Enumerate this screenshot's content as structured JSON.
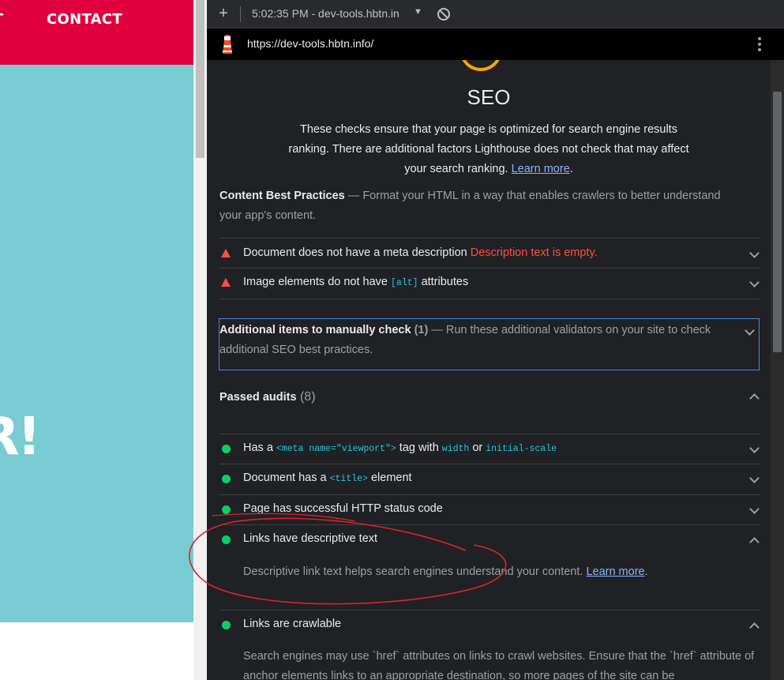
{
  "site": {
    "nav": [
      "UT",
      "CONTACT"
    ],
    "hero_text": "R!",
    "colors": {
      "header": "#e1003e",
      "hero": "#78ccd2"
    }
  },
  "devtools": {
    "report_select": "5:02:35 PM - dev-tools.hbtn.in",
    "url": "https://dev-tools.hbtn.info/"
  },
  "report": {
    "category_title": "SEO",
    "category_desc": "These checks ensure that your page is optimized for search engine results ranking. There are additional factors Lighthouse does not check that may affect your search ranking.",
    "learn_more": "Learn more",
    "content_group": {
      "title": "Content Best Practices",
      "separator": "—",
      "desc": "Format your HTML in a way that enables crawlers to better understand your app's content."
    },
    "failed_audits": [
      {
        "label": "Document does not have a meta description",
        "error": "Description text is empty."
      },
      {
        "label_before": "Image elements do not have",
        "code": "[alt]",
        "label_after": "attributes"
      }
    ],
    "manual_group": {
      "title": "Additional items to manually check",
      "count": "(1)",
      "separator": "—",
      "desc": "Run these additional validators on your site to check additional SEO best practices."
    },
    "passed": {
      "title": "Passed audits",
      "count": "(8)",
      "audits": [
        {
          "label_1": "Has a",
          "code_1": "<meta name=\"viewport\">",
          "label_2": "tag with",
          "code_2": "width",
          "label_3": "or",
          "code_3": "initial-scale"
        },
        {
          "label_1": "Document has a",
          "code_1": "<title>",
          "label_2": "element"
        },
        {
          "label": "Page has successful HTTP status code"
        },
        {
          "label": "Links have descriptive text",
          "desc": "Descriptive link text helps search engines understand your content.",
          "learn_more": "Learn more"
        },
        {
          "label": "Links are crawlable",
          "desc": "Search engines may use `href` attributes on links to crawl websites. Ensure that the `href` attribute of anchor elements links to an appropriate destination, so more pages of the site can be"
        }
      ]
    },
    "colors": {
      "fail": "#ff4e42",
      "pass": "#0cce6b",
      "average": "#ffa400",
      "link": "#8ab4f8",
      "code": "#26c6da"
    }
  }
}
